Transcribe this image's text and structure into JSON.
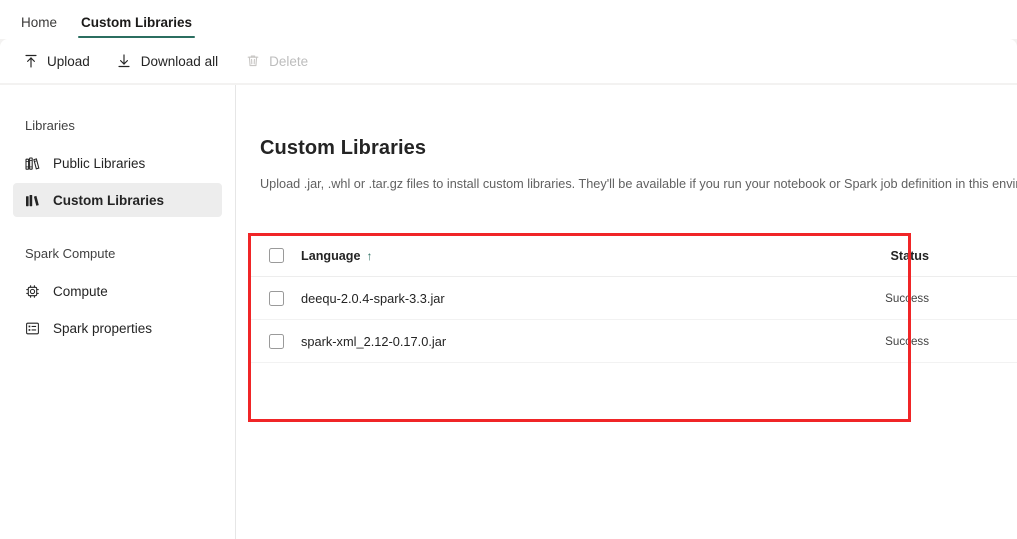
{
  "tabs": [
    {
      "label": "Home",
      "active": false
    },
    {
      "label": "Custom Libraries",
      "active": true
    }
  ],
  "toolbar": {
    "upload_label": "Upload",
    "download_all_label": "Download all",
    "delete_label": "Delete"
  },
  "sidebar": {
    "groups": [
      {
        "title": "Libraries",
        "items": [
          {
            "label": "Public Libraries",
            "icon": "books-outline-icon",
            "selected": false
          },
          {
            "label": "Custom Libraries",
            "icon": "books-filled-icon",
            "selected": true
          }
        ]
      },
      {
        "title": "Spark Compute",
        "items": [
          {
            "label": "Compute",
            "icon": "cpu-chip-icon",
            "selected": false
          },
          {
            "label": "Spark properties",
            "icon": "list-table-icon",
            "selected": false
          }
        ]
      }
    ]
  },
  "main": {
    "title": "Custom Libraries",
    "description": "Upload .jar, .whl or .tar.gz files to install custom libraries. They'll be available if you run your notebook or Spark job definition in this environment."
  },
  "table": {
    "columns": {
      "language": "Language",
      "sort_indicator": "↑",
      "status": "Status"
    },
    "rows": [
      {
        "name": "deequ-2.0.4-spark-3.3.jar",
        "status": "Success"
      },
      {
        "name": "spark-xml_2.12-0.17.0.jar",
        "status": "Success"
      }
    ]
  },
  "annotation": {
    "color": "#f02527"
  },
  "colors": {
    "accent_green": "#2b6e60",
    "toolbar_bg": "#f3f2f1",
    "selected_item_bg": "#ededed"
  }
}
